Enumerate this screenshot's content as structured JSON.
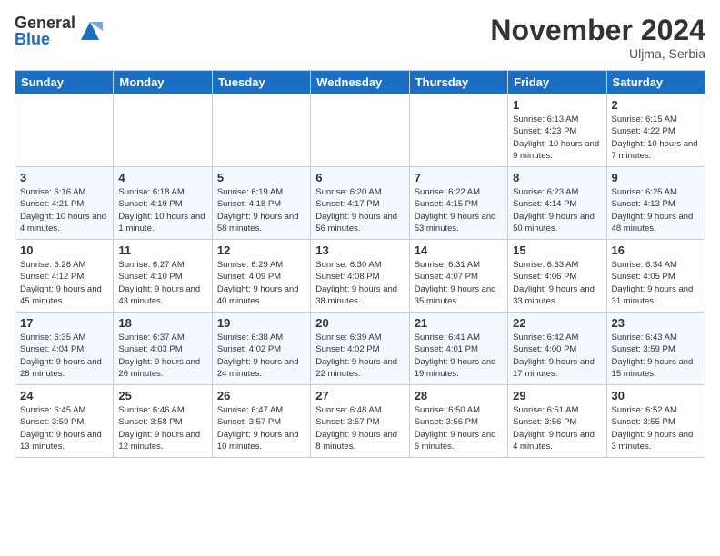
{
  "header": {
    "logo_general": "General",
    "logo_blue": "Blue",
    "month_title": "November 2024",
    "location": "Uljma, Serbia"
  },
  "days_of_week": [
    "Sunday",
    "Monday",
    "Tuesday",
    "Wednesday",
    "Thursday",
    "Friday",
    "Saturday"
  ],
  "weeks": [
    [
      {
        "day": "",
        "info": ""
      },
      {
        "day": "",
        "info": ""
      },
      {
        "day": "",
        "info": ""
      },
      {
        "day": "",
        "info": ""
      },
      {
        "day": "",
        "info": ""
      },
      {
        "day": "1",
        "info": "Sunrise: 6:13 AM\nSunset: 4:23 PM\nDaylight: 10 hours and 9 minutes."
      },
      {
        "day": "2",
        "info": "Sunrise: 6:15 AM\nSunset: 4:22 PM\nDaylight: 10 hours and 7 minutes."
      }
    ],
    [
      {
        "day": "3",
        "info": "Sunrise: 6:16 AM\nSunset: 4:21 PM\nDaylight: 10 hours and 4 minutes."
      },
      {
        "day": "4",
        "info": "Sunrise: 6:18 AM\nSunset: 4:19 PM\nDaylight: 10 hours and 1 minute."
      },
      {
        "day": "5",
        "info": "Sunrise: 6:19 AM\nSunset: 4:18 PM\nDaylight: 9 hours and 58 minutes."
      },
      {
        "day": "6",
        "info": "Sunrise: 6:20 AM\nSunset: 4:17 PM\nDaylight: 9 hours and 56 minutes."
      },
      {
        "day": "7",
        "info": "Sunrise: 6:22 AM\nSunset: 4:15 PM\nDaylight: 9 hours and 53 minutes."
      },
      {
        "day": "8",
        "info": "Sunrise: 6:23 AM\nSunset: 4:14 PM\nDaylight: 9 hours and 50 minutes."
      },
      {
        "day": "9",
        "info": "Sunrise: 6:25 AM\nSunset: 4:13 PM\nDaylight: 9 hours and 48 minutes."
      }
    ],
    [
      {
        "day": "10",
        "info": "Sunrise: 6:26 AM\nSunset: 4:12 PM\nDaylight: 9 hours and 45 minutes."
      },
      {
        "day": "11",
        "info": "Sunrise: 6:27 AM\nSunset: 4:10 PM\nDaylight: 9 hours and 43 minutes."
      },
      {
        "day": "12",
        "info": "Sunrise: 6:29 AM\nSunset: 4:09 PM\nDaylight: 9 hours and 40 minutes."
      },
      {
        "day": "13",
        "info": "Sunrise: 6:30 AM\nSunset: 4:08 PM\nDaylight: 9 hours and 38 minutes."
      },
      {
        "day": "14",
        "info": "Sunrise: 6:31 AM\nSunset: 4:07 PM\nDaylight: 9 hours and 35 minutes."
      },
      {
        "day": "15",
        "info": "Sunrise: 6:33 AM\nSunset: 4:06 PM\nDaylight: 9 hours and 33 minutes."
      },
      {
        "day": "16",
        "info": "Sunrise: 6:34 AM\nSunset: 4:05 PM\nDaylight: 9 hours and 31 minutes."
      }
    ],
    [
      {
        "day": "17",
        "info": "Sunrise: 6:35 AM\nSunset: 4:04 PM\nDaylight: 9 hours and 28 minutes."
      },
      {
        "day": "18",
        "info": "Sunrise: 6:37 AM\nSunset: 4:03 PM\nDaylight: 9 hours and 26 minutes."
      },
      {
        "day": "19",
        "info": "Sunrise: 6:38 AM\nSunset: 4:02 PM\nDaylight: 9 hours and 24 minutes."
      },
      {
        "day": "20",
        "info": "Sunrise: 6:39 AM\nSunset: 4:02 PM\nDaylight: 9 hours and 22 minutes."
      },
      {
        "day": "21",
        "info": "Sunrise: 6:41 AM\nSunset: 4:01 PM\nDaylight: 9 hours and 19 minutes."
      },
      {
        "day": "22",
        "info": "Sunrise: 6:42 AM\nSunset: 4:00 PM\nDaylight: 9 hours and 17 minutes."
      },
      {
        "day": "23",
        "info": "Sunrise: 6:43 AM\nSunset: 3:59 PM\nDaylight: 9 hours and 15 minutes."
      }
    ],
    [
      {
        "day": "24",
        "info": "Sunrise: 6:45 AM\nSunset: 3:59 PM\nDaylight: 9 hours and 13 minutes."
      },
      {
        "day": "25",
        "info": "Sunrise: 6:46 AM\nSunset: 3:58 PM\nDaylight: 9 hours and 12 minutes."
      },
      {
        "day": "26",
        "info": "Sunrise: 6:47 AM\nSunset: 3:57 PM\nDaylight: 9 hours and 10 minutes."
      },
      {
        "day": "27",
        "info": "Sunrise: 6:48 AM\nSunset: 3:57 PM\nDaylight: 9 hours and 8 minutes."
      },
      {
        "day": "28",
        "info": "Sunrise: 6:50 AM\nSunset: 3:56 PM\nDaylight: 9 hours and 6 minutes."
      },
      {
        "day": "29",
        "info": "Sunrise: 6:51 AM\nSunset: 3:56 PM\nDaylight: 9 hours and 4 minutes."
      },
      {
        "day": "30",
        "info": "Sunrise: 6:52 AM\nSunset: 3:55 PM\nDaylight: 9 hours and 3 minutes."
      }
    ]
  ]
}
